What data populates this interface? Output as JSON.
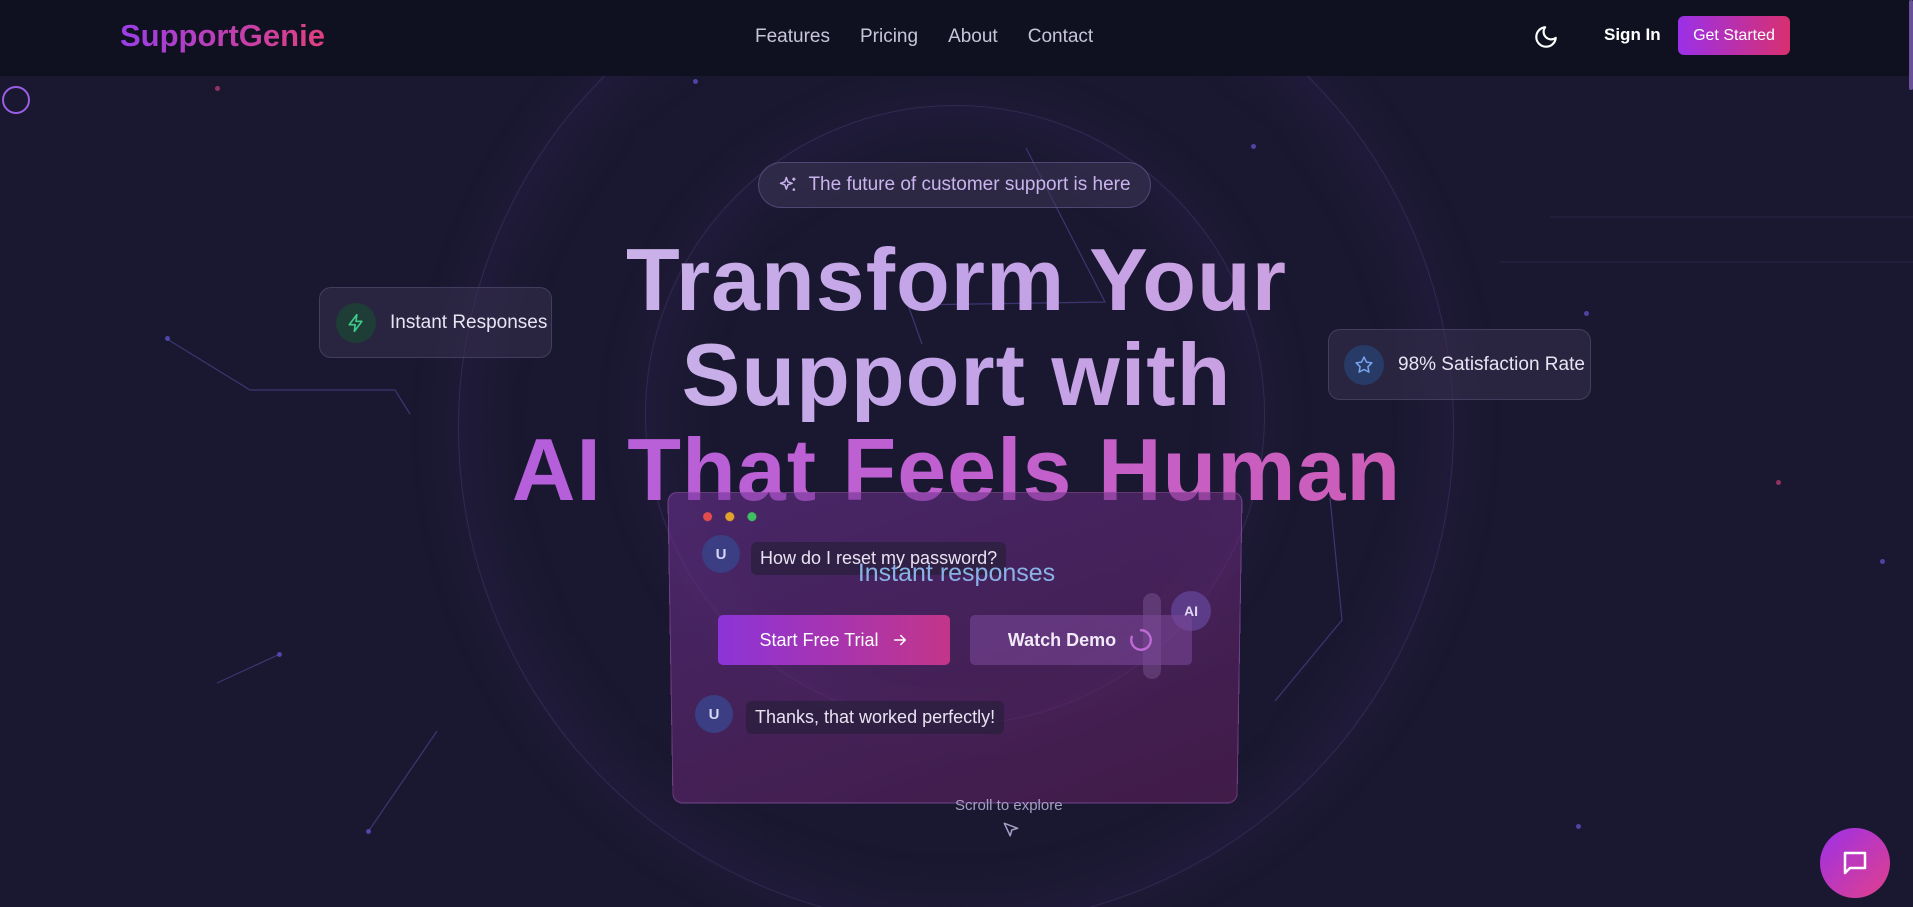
{
  "brand": {
    "name": "SupportGenie"
  },
  "nav": {
    "links": [
      "Features",
      "Pricing",
      "About",
      "Contact"
    ],
    "theme_icon": "moon-icon",
    "sign_in": "Sign In",
    "get_started": "Get Started"
  },
  "hero": {
    "pill_text": "The future of customer support is here",
    "pill_icon": "sparkles-icon",
    "headline_line1": "Transform Your",
    "headline_line2": "Support with",
    "headline_line3": "AI That Feels Human",
    "overlay_text": "Instant responses"
  },
  "floating_cards": {
    "left": {
      "label": "Instant Responses",
      "icon": "lightning-icon"
    },
    "right": {
      "label": "98% Satisfaction Rate",
      "icon": "star-icon"
    }
  },
  "chat_preview": {
    "user_initial": "U",
    "ai_initial": "AI",
    "message_1": "How do I reset my password?",
    "message_2": "Thanks, that worked perfectly!"
  },
  "cta": {
    "primary": "Start Free Trial",
    "secondary": "Watch Demo"
  },
  "scroll_hint": "Scroll to explore",
  "colors": {
    "background": "#1a1830",
    "nav_bg": "#0f1121",
    "accent_start": "#9b30e8",
    "accent_end": "#e0407f"
  }
}
